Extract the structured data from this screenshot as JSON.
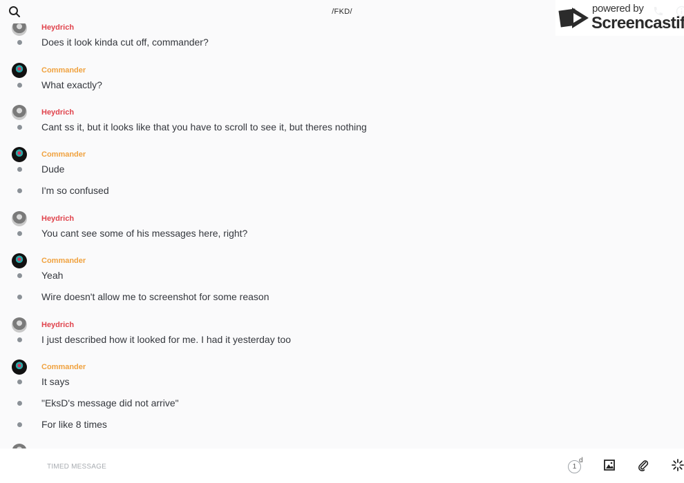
{
  "header": {
    "conversation_title": "/FKD/"
  },
  "watermark": {
    "line1": "powered by",
    "brand": "Screencastify"
  },
  "messages": [
    {
      "sender": "Heydrich",
      "text": "Does it look kinda cut off, commander?"
    },
    {
      "sender": "Commander",
      "text": "What exactly?"
    },
    {
      "sender": "Heydrich",
      "text": "Cant ss it, but it looks like that you have to scroll to see it, but theres nothing"
    },
    {
      "sender": "Commander",
      "text": "Dude"
    },
    {
      "sender": null,
      "text": "I'm so confused"
    },
    {
      "sender": "Heydrich",
      "text": "You cant see some of his messages here, right?"
    },
    {
      "sender": "Commander",
      "text": "Yeah"
    },
    {
      "sender": null,
      "text": "Wire doesn't allow me to screenshot for some reason"
    },
    {
      "sender": "Heydrich",
      "text": "I just described how it looked for me. I had it yesterday too"
    },
    {
      "sender": "Commander",
      "text": "It says"
    },
    {
      "sender": null,
      "text": "\"EksD's message did not arrive\""
    },
    {
      "sender": null,
      "text": "For like 8 times"
    }
  ],
  "composer": {
    "placeholder": "TIMED MESSAGE",
    "timer_value": "1",
    "timer_unit": "d"
  },
  "icons": {
    "search": "search-icon",
    "call": "phone-icon",
    "info": "info-icon",
    "image": "image-icon",
    "attach": "paperclip-icon",
    "ping": "ping-icon"
  },
  "colors": {
    "heydrich": "#e0434c",
    "commander": "#f0a23f"
  }
}
